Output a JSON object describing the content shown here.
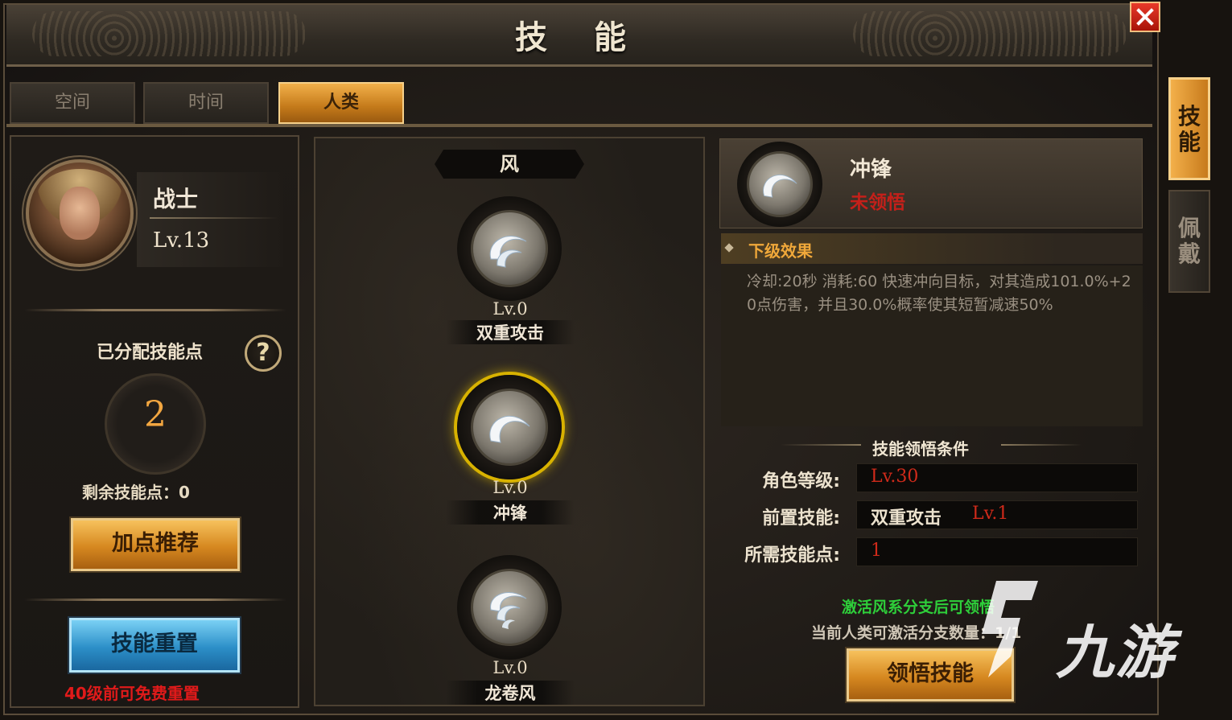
{
  "window": {
    "title": "技 能"
  },
  "tabs": [
    {
      "label": "空间",
      "active": false
    },
    {
      "label": "时间",
      "active": false
    },
    {
      "label": "人类",
      "active": true
    }
  ],
  "side_tabs": [
    {
      "label": "技能",
      "active": true
    },
    {
      "label": "佩戴",
      "active": false
    }
  ],
  "character": {
    "class_name": "战士",
    "level": "Lv.13"
  },
  "skill_points": {
    "allocated_label": "已分配技能点",
    "allocated_value": "2",
    "remaining_text": "剩余技能点：0",
    "help_symbol": "?"
  },
  "buttons": {
    "recommend": "加点推荐",
    "reset": "技能重置",
    "reset_note": "40级前可免费重置",
    "learn": "领悟技能",
    "close_icon": "close-icon"
  },
  "skill_tree": {
    "branch": "风",
    "skills": [
      {
        "level": "Lv.0",
        "name": "双重攻击",
        "selected": false
      },
      {
        "level": "Lv.0",
        "name": "冲锋",
        "selected": true
      },
      {
        "level": "Lv.0",
        "name": "龙卷风",
        "selected": false
      }
    ]
  },
  "detail": {
    "name": "冲锋",
    "status": "未领悟",
    "next_effect_title": "下级效果",
    "next_effect_text": "冷却:20秒 消耗:60 快速冲向目标，对其造成101.0%+20点伤害，并且30.0%概率使其短暂减速50%",
    "conditions_title": "技能领悟条件",
    "conditions": [
      {
        "label": "角色等级:",
        "value": "Lv.30",
        "extra": ""
      },
      {
        "label": "前置技能:",
        "value": "双重攻击",
        "extra": "Lv.1"
      },
      {
        "label": "所需技能点:",
        "value": "1",
        "extra": ""
      }
    ],
    "activate_note": "激活风系分支后可领悟",
    "branch_count_note": "当前人类可激活分支数量：1/1"
  },
  "watermark": {
    "text": "九游"
  },
  "colors": {
    "accent_gold": "#d68820",
    "accent_blue": "#2c8fc8",
    "status_red": "#c4201a",
    "note_green": "#2ecf3a",
    "selected_ring": "#d8b200"
  }
}
